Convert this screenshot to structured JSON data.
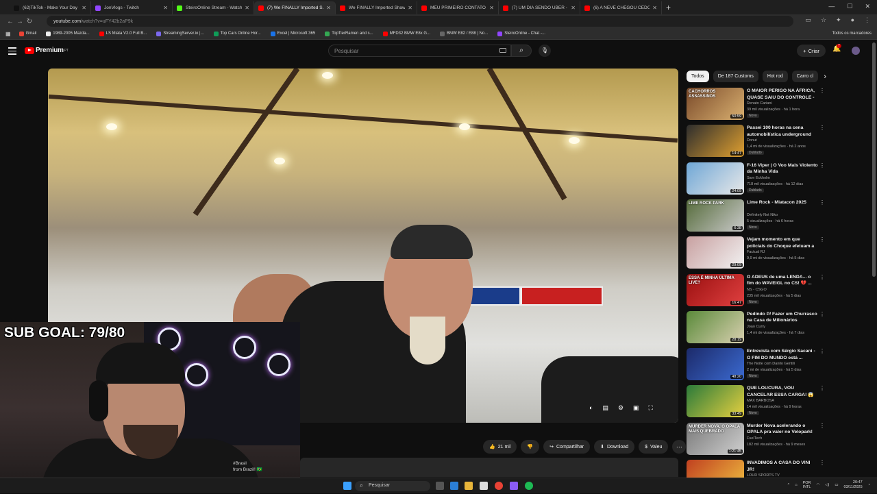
{
  "browser": {
    "tabs": [
      {
        "label": "(62)TikTok - Make Your Day",
        "color": "#111111",
        "active": false
      },
      {
        "label": "JonVlogs - Twitch",
        "color": "#9146ff",
        "active": false
      },
      {
        "label": "SteiroOnline Stream - Watch Li...",
        "color": "#53fc18",
        "active": false
      },
      {
        "label": "(7) We FINALLY Imported S...",
        "color": "#ff0000",
        "active": true
      },
      {
        "label": "We FINALLY Imported Shawn's...",
        "color": "#ff0000",
        "active": false
      },
      {
        "label": "MEU PRIMEIRO CONTATO COM...",
        "color": "#ff0000",
        "active": false
      },
      {
        "label": "(7) UM DIA SENDO UBER - You...",
        "color": "#ff0000",
        "active": false
      },
      {
        "label": "(6) A NEVE CHEGOU CEDO ES...",
        "color": "#ff0000",
        "active": false
      }
    ],
    "url": "youtube.com",
    "url_rest": "/watch?v=uFY42b2aP9k",
    "bookmarks": [
      {
        "label": "Gmail",
        "color": "#ea4335"
      },
      {
        "label": "1989-2005 Mazda...",
        "color": "#eeeeee"
      },
      {
        "label": "LS Miata V2.0 Full B...",
        "color": "#ff0000"
      },
      {
        "label": "StreamingServer.io |...",
        "color": "#7b68ee"
      },
      {
        "label": "Top Cars Online Hor...",
        "color": "#0f9d58"
      },
      {
        "label": "Excel | Microsoft 365",
        "color": "#1a73e8"
      },
      {
        "label": "TopTierRamen and s...",
        "color": "#34a853"
      },
      {
        "label": "MFD32 BMW E8x G...",
        "color": "#ff0000"
      },
      {
        "label": "BMW E82 / E88 | No...",
        "color": "#666666"
      },
      {
        "label": "SteiroOnline - Chat -...",
        "color": "#9146ff"
      }
    ],
    "bookmarks_right": "Todos os marcadores"
  },
  "youtube": {
    "logo": "Premium",
    "logo_sup": "PT",
    "search_placeholder": "Pesquisar",
    "create_label": "Criar",
    "notif_count": "7",
    "actions": {
      "likes": "21 mil",
      "share": "Compartilhar",
      "download": "Download",
      "thanks": "Valeu"
    },
    "chips": [
      "Todos",
      "De 187 Customs",
      "Hot rod",
      "Carro cl"
    ],
    "recs": [
      {
        "title": "O MAIOR PERIGO NA ÁFRICA, QUASE SAIU DO CONTROLE - ...",
        "channel": "Renato Cariani",
        "meta": "39 mil visualizações · há 1 hora",
        "badge": "Novo",
        "dur": "50:59",
        "c1": "#7a4a2a",
        "c2": "#d9b070",
        "thumb_text": "CACHORROS ASSASSINOS"
      },
      {
        "title": "Passei 100 horas na cena automobilística underground d...",
        "channel": "Donut",
        "meta": "1,4 mi de visualizações · há 2 anos",
        "badge": "Dublado",
        "dur": "14:47",
        "c1": "#2d2d2d",
        "c2": "#e0a030",
        "thumb_text": ""
      },
      {
        "title": "F-16 Viper | O Voo Mais Violento da Minha Vida",
        "channel": "Sam Eckholm",
        "meta": "718 mil visualizações · há 12 dias",
        "badge": "Dublado",
        "dur": "24:09",
        "c1": "#6fa7d6",
        "c2": "#e8e8e8",
        "thumb_text": ""
      },
      {
        "title": "Lime Rock - Miatacon 2025",
        "channel": "Definitely Not Niko",
        "meta": "5 visualizações · há 6 horas",
        "badge": "Novo",
        "dur": "6:38",
        "c1": "#556b3a",
        "c2": "#c9c9c9",
        "thumb_text": "LIME ROCK PARK"
      },
      {
        "title": "Vejam momento em que policiais do Choque efetuam a ...",
        "channel": "Factual RJ",
        "meta": "9,9 mi de visualizações · há 5 dias",
        "badge": "",
        "dur": "29:09",
        "c1": "#c8a0a0",
        "c2": "#f2f2f2",
        "thumb_text": ""
      },
      {
        "title": "O ADEUS de uma LENDA... o fim do WAVEIGL no CS! 💔 ...",
        "channel": "NS - CSGO",
        "meta": "235 mil visualizações · há 5 dias",
        "badge": "Novo",
        "dur": "16:47",
        "c1": "#9a1010",
        "c2": "#e04040",
        "thumb_text": "ESSA É MINHA ÚLTIMA LIVE?"
      },
      {
        "title": "Pedindo P/ Fazer um Churrasco na Casa de Milionários",
        "channel": "Joao Curry",
        "meta": "1,4 mi de visualizações · há 7 dias",
        "badge": "",
        "dur": "28:19",
        "c1": "#5a8a3a",
        "c2": "#d9d0b0",
        "thumb_text": ""
      },
      {
        "title": "Entrevista com Sérgio Sacani - O FIM DO MUNDO está ...",
        "channel": "The Noite com Danilo Gentili",
        "meta": "2 mi de visualizações · há 5 dias",
        "badge": "Novo",
        "dur": "48:20",
        "c1": "#1c2a6a",
        "c2": "#3b6ad0",
        "thumb_text": ""
      },
      {
        "title": "QUE LOUCURA, VOU CANCELAR ESSA CARGA! 😱 us",
        "channel": "MAX BARBOSA",
        "meta": "14 mil visualizações · há 9 horas",
        "badge": "Novo",
        "dur": "33:49",
        "c1": "#2a7a3a",
        "c2": "#e6d040",
        "thumb_text": ""
      },
      {
        "title": "Murder Nova acelerando o OPALA pra valer no Velopark!",
        "channel": "FuelTech",
        "meta": "182 mil visualizações · há 9 meses",
        "badge": "",
        "dur": "1:21:45",
        "c1": "#7a7a7a",
        "c2": "#cfcfcf",
        "thumb_text": "MURDER NOVA, O OPALA MAIS QUEBRADO"
      },
      {
        "title": "INVADIMOS A CASA DO VINI JR!",
        "channel": "LOUD SPORTS TV",
        "meta": "",
        "badge": "",
        "dur": "",
        "c1": "#c04020",
        "c2": "#f0c040",
        "thumb_text": ""
      }
    ]
  },
  "overlay": {
    "sub_goal": "SUB GOAL: 79/80",
    "caption_line1": "#Brasil",
    "caption_line2": "from Brazil! 🇧🇷"
  },
  "taskbar": {
    "search": "Pesquisar",
    "lang": "POR",
    "lang2": "INTL",
    "time": "20:47",
    "date": "03/11/2025"
  }
}
